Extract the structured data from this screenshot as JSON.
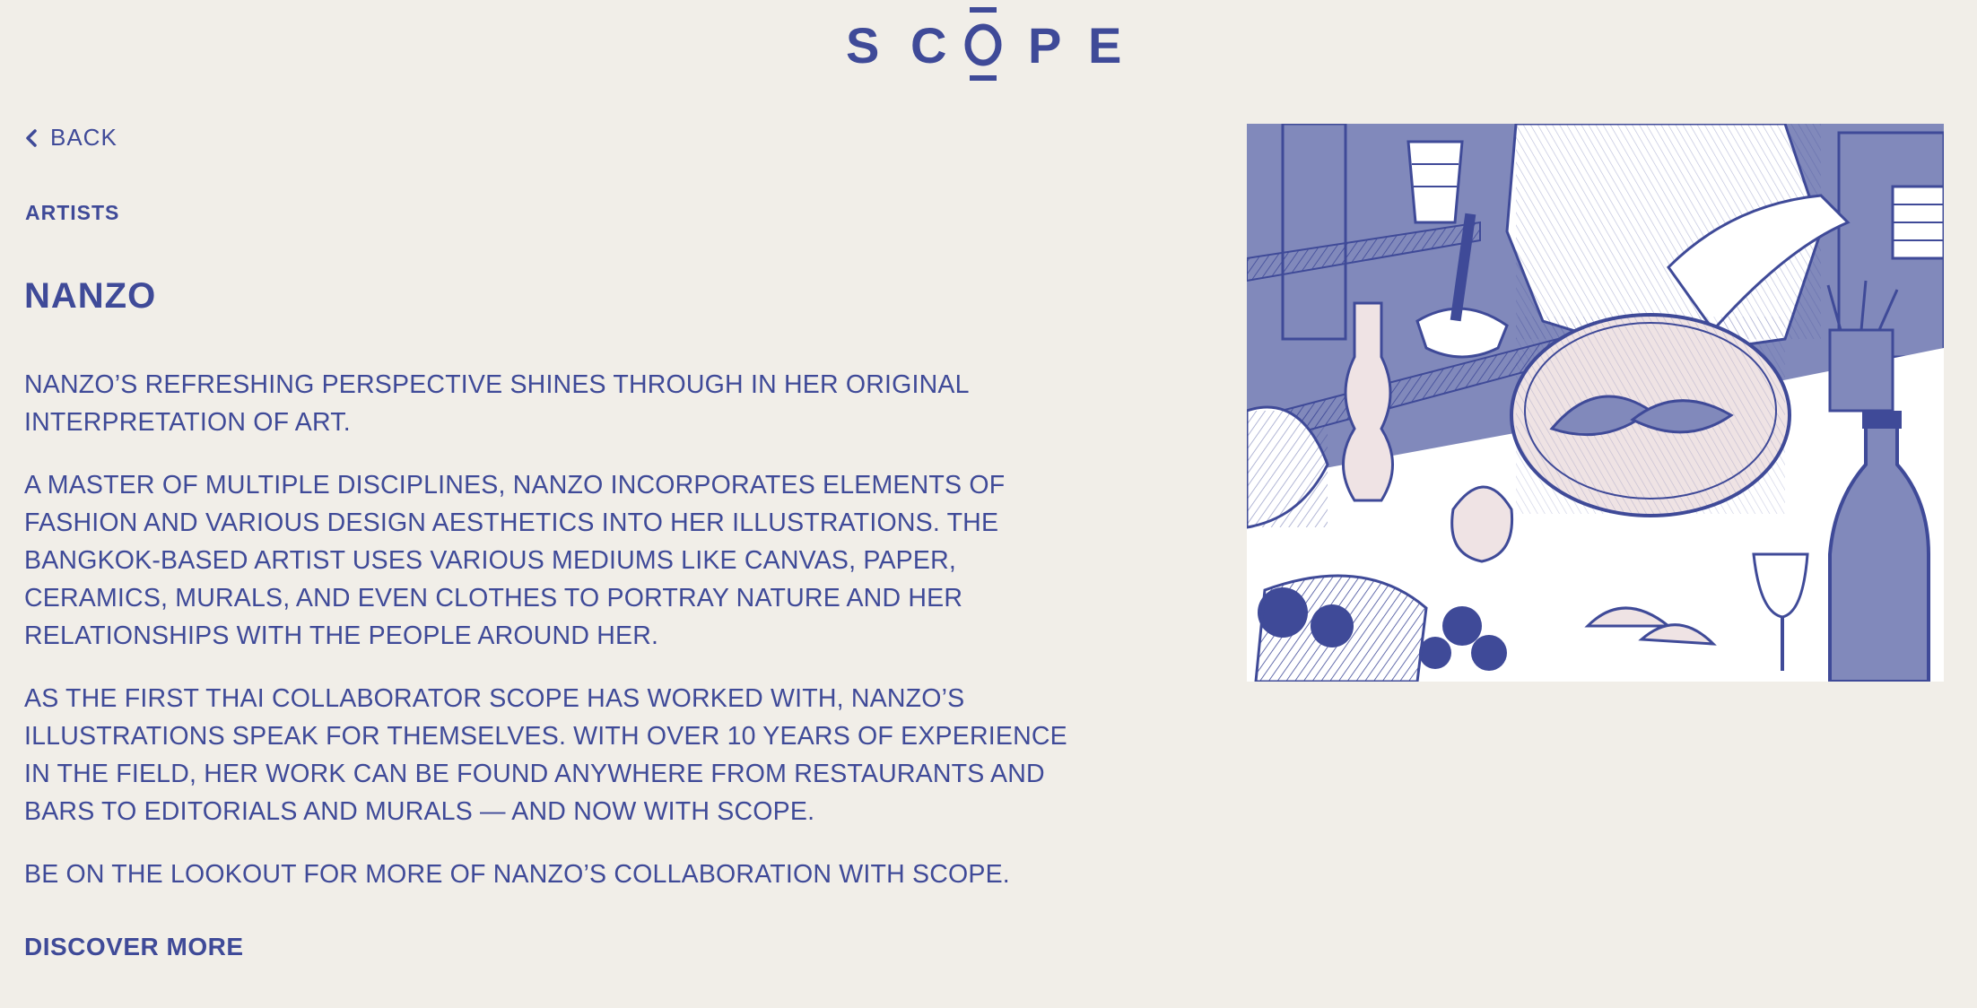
{
  "header": {
    "logo_text": "SCOPE",
    "logo_icon": "scope-wordmark"
  },
  "nav": {
    "back_label": "BACK",
    "back_icon": "chevron-left-icon"
  },
  "section": {
    "label": "ARTISTS"
  },
  "artist": {
    "name": "NANZO",
    "bio": [
      "NANZO’S REFRESHING PERSPECTIVE SHINES THROUGH IN HER ORIGINAL INTERPRETATION OF ART.",
      "A MASTER OF MULTIPLE DISCIPLINES, NANZO INCORPORATES ELEMENTS OF FASHION AND VARIOUS DESIGN AESTHETICS INTO HER ILLUSTRATIONS. THE BANGKOK-BASED ARTIST USES VARIOUS MEDIUMS LIKE CANVAS, PAPER, CERAMICS, MURALS, AND EVEN CLOTHES TO PORTRAY NATURE AND HER RELATIONSHIPS WITH THE PEOPLE AROUND HER.",
      "AS THE FIRST THAI COLLABORATOR SCOPE HAS WORKED WITH, NANZO’S ILLUSTRATIONS SPEAK FOR THEMSELVES. WITH OVER 10 YEARS OF EXPERIENCE IN THE FIELD, HER WORK CAN BE FOUND ANYWHERE FROM RESTAURANTS AND BARS TO EDITORIALS AND MURALS — AND NOW WITH SCOPE.",
      "BE ON THE LOOKOUT FOR MORE OF NANZO’S COLLABORATION WITH SCOPE."
    ],
    "cta_label": "DISCOVER MORE"
  },
  "colors": {
    "background": "#f1eee8",
    "brand_blue": "#3f4a98",
    "illustration_fill": "#8189bb",
    "illustration_pink": "#efe3e4"
  }
}
